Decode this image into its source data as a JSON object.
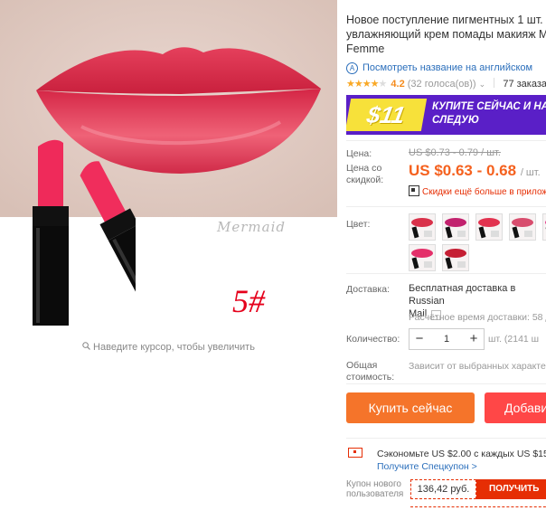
{
  "product": {
    "title": "Новое поступление пигментных 1 шт. увлажняющий крем помады макияж M Femme",
    "translate_link": "Посмотреть название на английском",
    "rating_value": "4.2",
    "stars": 4,
    "reviews": "(32 голоса(ов))",
    "orders": "77 заказа(",
    "image": {
      "watermark": "Mermaid",
      "shade_label": "5#",
      "zoom_hint": "Наведите курсор, чтобы увеличить"
    }
  },
  "banner": {
    "price": "$11",
    "text": "КУПИТЕ СЕЙЧАС И НА СЛЕДУЮ",
    "colors": {
      "background": "#5a1fc7",
      "price_bg": "#f7e13a"
    }
  },
  "pricing": {
    "price_label": "Цена:",
    "old_price": "US $0.73 - 0.79 / шт.",
    "discount_label": "Цена со скидкой:",
    "new_price": "US $0.63 - 0.68",
    "unit": "/ шт.",
    "app_deal": "Скидки ещё больше в прилож"
  },
  "color": {
    "label": "Цвет:",
    "swatches": [
      {
        "name": "shade-1",
        "color": "#d9314a"
      },
      {
        "name": "shade-2",
        "color": "#c2226e"
      },
      {
        "name": "shade-3",
        "color": "#e2324f"
      },
      {
        "name": "shade-4",
        "color": "#d84d6e"
      },
      {
        "name": "shade-5",
        "color": "#e43a8a"
      },
      {
        "name": "shade-6",
        "color": "#e4306a"
      },
      {
        "name": "shade-7",
        "color": "#c51f34"
      }
    ]
  },
  "shipping": {
    "label": "Доставка:",
    "text": "Бесплатная доставка в Russian",
    "text2": "Mail",
    "time": "Расчётное время доставки: 58 д"
  },
  "quantity": {
    "label": "Количество:",
    "value": "1",
    "minus": "−",
    "plus": "+",
    "info": "шт. (2141 ш"
  },
  "total": {
    "label": "Общая стоимость:",
    "note": "Зависит от выбранных характери"
  },
  "actions": {
    "buy_now": "Купить сейчас",
    "add_to_cart": "Добави"
  },
  "coupons": {
    "save_text": "Сэкономьте US $2.00 с каждых US $15.00",
    "save_link": "Получите Спецкупон >",
    "new_user_label": "Купон нового пользователя",
    "new_user_value": "136,42 руб.",
    "get_button": "ПОЛУЧИТЬ"
  },
  "colors": {
    "accent_orange": "#f5611e",
    "buy_button": "#f5742a",
    "cart_button": "#ff4747",
    "link_blue": "#2a6ebb",
    "coupon_red": "#e62e04"
  }
}
